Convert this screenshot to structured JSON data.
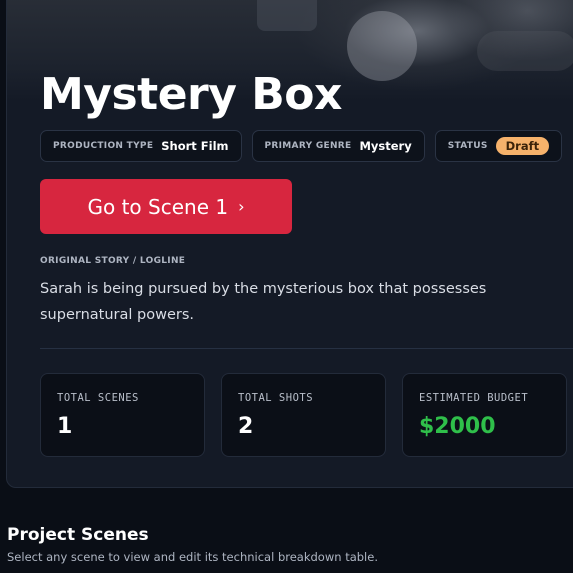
{
  "project": {
    "title": "Mystery Box",
    "meta": [
      {
        "label": "PRODUCTION TYPE",
        "value": "Short Film"
      },
      {
        "label": "PRIMARY GENRE",
        "value": "Mystery"
      },
      {
        "label": "STATUS",
        "value": "Draft"
      }
    ],
    "cta_label": "Go to Scene 1",
    "cta_chevron": "›",
    "logline_label": "ORIGINAL STORY / LOGLINE",
    "logline": "Sarah is being pursued by the mysterious box that possesses supernatural powers."
  },
  "stats": [
    {
      "label": "TOTAL SCENES",
      "value": "1"
    },
    {
      "label": "TOTAL SHOTS",
      "value": "2"
    },
    {
      "label": "ESTIMATED BUDGET",
      "value": "$2000"
    }
  ],
  "scenes_section": {
    "title": "Project Scenes",
    "subtitle": "Select any scene to view and edit its technical breakdown table."
  },
  "colors": {
    "accent": "#d7263f",
    "status_draft": "#f6b26b",
    "budget": "#2fbf4a"
  }
}
